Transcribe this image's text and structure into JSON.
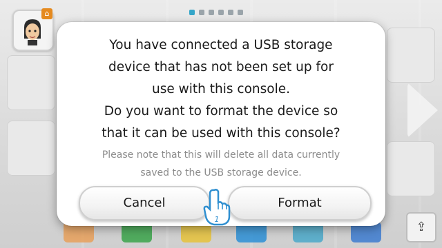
{
  "dialog": {
    "message_lines": [
      "You have connected a USB storage",
      "device that has not been set up for",
      "use with this console.",
      "Do you want to format the device so",
      "that it can be used with this console?"
    ],
    "note_lines": [
      "Please note that this will delete all data currently",
      "saved to the USB storage device."
    ],
    "cancel_label": "Cancel",
    "format_label": "Format"
  },
  "pointer": {
    "player_number": "1"
  },
  "background": {
    "page_dot_count": 6,
    "active_page": 1,
    "accent_color": "#35a6c9"
  }
}
